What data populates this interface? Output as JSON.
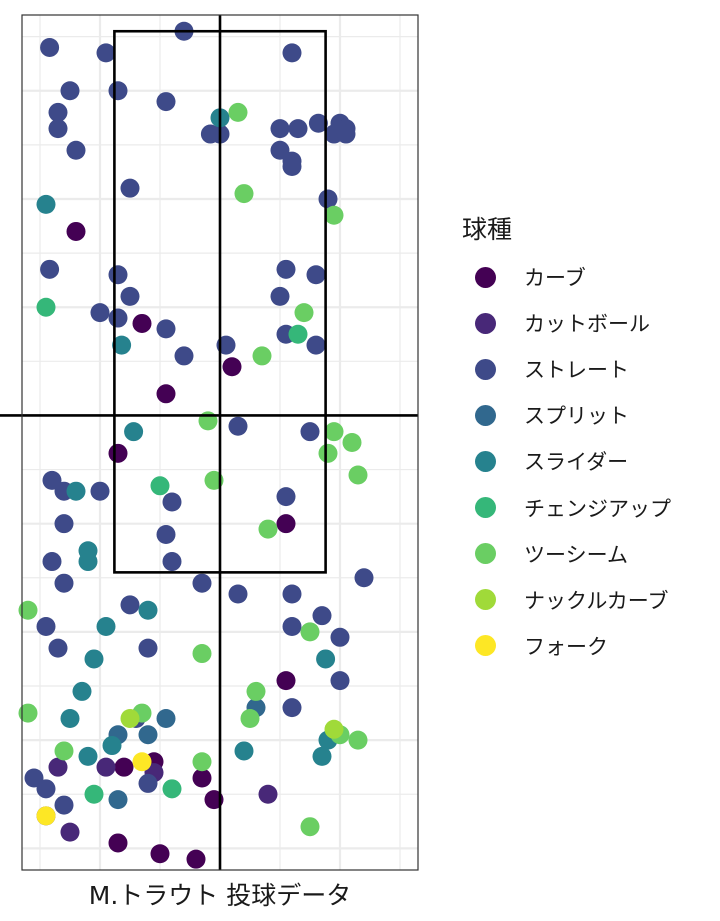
{
  "chart_data": {
    "type": "scatter",
    "title": "",
    "xlabel": "M.トラウト 投球データ",
    "ylabel": "",
    "xlim": [
      -1.65,
      1.65
    ],
    "ylim": [
      -1.2,
      6.7
    ],
    "grid": true,
    "legend_position": "right",
    "legend_title": "球種",
    "strike_zone": {
      "x": [
        -0.88,
        0.88
      ],
      "y": [
        1.55,
        6.55
      ]
    },
    "series": [
      {
        "name": "カーブ",
        "color": "#440154",
        "points": [
          [
            -1.2,
            4.7
          ],
          [
            -0.65,
            3.85
          ],
          [
            0.1,
            3.45
          ],
          [
            -0.45,
            3.2
          ],
          [
            -0.85,
            2.65
          ],
          [
            0.55,
            2.0
          ],
          [
            0.55,
            0.55
          ],
          [
            -0.8,
            -0.25
          ],
          [
            -0.55,
            -0.2
          ],
          [
            -0.15,
            -0.35
          ],
          [
            -0.05,
            -0.55
          ],
          [
            -0.5,
            -1.05
          ],
          [
            -0.2,
            -1.1
          ],
          [
            -0.85,
            -0.95
          ]
        ]
      },
      {
        "name": "カットボール",
        "color": "#482878",
        "points": [
          [
            -1.35,
            -0.25
          ],
          [
            -0.95,
            -0.25
          ],
          [
            -1.45,
            -0.7
          ],
          [
            -1.25,
            -0.85
          ],
          [
            0.4,
            -0.5
          ],
          [
            -0.55,
            -0.3
          ]
        ]
      },
      {
        "name": "ストレート",
        "color": "#3E4A89",
        "points": [
          [
            -1.42,
            6.4
          ],
          [
            -0.95,
            6.35
          ],
          [
            -0.3,
            6.55
          ],
          [
            0.6,
            6.35
          ],
          [
            -1.25,
            6.0
          ],
          [
            -0.85,
            6.0
          ],
          [
            -0.45,
            5.9
          ],
          [
            -1.35,
            5.8
          ],
          [
            -1.35,
            5.65
          ],
          [
            -1.2,
            5.45
          ],
          [
            -0.08,
            5.6
          ],
          [
            0.0,
            5.6
          ],
          [
            0.5,
            5.65
          ],
          [
            0.65,
            5.65
          ],
          [
            0.82,
            5.7
          ],
          [
            1.0,
            5.7
          ],
          [
            1.05,
            5.65
          ],
          [
            0.95,
            5.6
          ],
          [
            1.05,
            5.6
          ],
          [
            0.5,
            5.45
          ],
          [
            0.6,
            5.35
          ],
          [
            0.6,
            5.3
          ],
          [
            -0.75,
            5.1
          ],
          [
            0.9,
            5.0
          ],
          [
            -1.42,
            4.35
          ],
          [
            -0.85,
            4.3
          ],
          [
            0.55,
            4.35
          ],
          [
            0.8,
            4.3
          ],
          [
            -0.75,
            4.1
          ],
          [
            0.5,
            4.1
          ],
          [
            -1.0,
            3.95
          ],
          [
            -0.85,
            3.9
          ],
          [
            -0.45,
            3.8
          ],
          [
            0.55,
            3.75
          ],
          [
            0.05,
            3.65
          ],
          [
            0.8,
            3.65
          ],
          [
            -0.3,
            3.55
          ],
          [
            0.15,
            2.9
          ],
          [
            0.75,
            2.85
          ],
          [
            -1.4,
            2.4
          ],
          [
            -1.3,
            2.3
          ],
          [
            -1.0,
            2.3
          ],
          [
            0.55,
            2.25
          ],
          [
            -0.4,
            2.2
          ],
          [
            -1.3,
            2.0
          ],
          [
            -0.45,
            1.9
          ],
          [
            -1.4,
            1.65
          ],
          [
            -1.3,
            1.45
          ],
          [
            -0.4,
            1.65
          ],
          [
            -0.15,
            1.45
          ],
          [
            0.15,
            1.35
          ],
          [
            0.6,
            1.35
          ],
          [
            1.2,
            1.5
          ],
          [
            -0.75,
            1.25
          ],
          [
            0.85,
            1.15
          ],
          [
            -1.45,
            1.05
          ],
          [
            0.6,
            1.05
          ],
          [
            1.0,
            0.95
          ],
          [
            -1.35,
            0.85
          ],
          [
            -0.6,
            0.85
          ],
          [
            1.0,
            0.55
          ],
          [
            0.6,
            0.3
          ],
          [
            -0.7,
            0.2
          ],
          [
            -1.55,
            -0.35
          ],
          [
            -1.45,
            -0.45
          ],
          [
            -0.6,
            -0.4
          ],
          [
            -1.3,
            -0.6
          ]
        ]
      },
      {
        "name": "スプリット",
        "color": "#31688E",
        "points": [
          [
            -0.85,
            0.05
          ],
          [
            -0.6,
            0.05
          ],
          [
            -0.45,
            0.2
          ],
          [
            0.3,
            0.3
          ],
          [
            -0.85,
            -0.55
          ]
        ]
      },
      {
        "name": "スライダー",
        "color": "#26828E",
        "points": [
          [
            -1.45,
            4.95
          ],
          [
            -0.82,
            3.65
          ],
          [
            -0.72,
            2.85
          ],
          [
            -1.2,
            2.3
          ],
          [
            -1.1,
            1.75
          ],
          [
            -1.1,
            1.65
          ],
          [
            -0.95,
            1.05
          ],
          [
            0.0,
            5.75
          ],
          [
            -0.6,
            1.2
          ],
          [
            -1.05,
            0.75
          ],
          [
            0.88,
            0.75
          ],
          [
            -1.15,
            0.45
          ],
          [
            -1.25,
            0.2
          ],
          [
            0.9,
            0.0
          ],
          [
            -0.9,
            -0.05
          ],
          [
            0.2,
            -0.1
          ],
          [
            -1.1,
            -0.15
          ],
          [
            0.85,
            -0.15
          ]
        ]
      },
      {
        "name": "チェンジアップ",
        "color": "#35B779",
        "points": [
          [
            -1.45,
            4.0
          ],
          [
            0.65,
            3.75
          ],
          [
            -0.5,
            2.35
          ],
          [
            -1.05,
            -0.5
          ],
          [
            -0.4,
            -0.45
          ]
        ]
      },
      {
        "name": "ツーシーム",
        "color": "#6ACE63",
        "points": [
          [
            0.15,
            5.8
          ],
          [
            0.2,
            5.05
          ],
          [
            0.95,
            4.85
          ],
          [
            0.7,
            3.95
          ],
          [
            0.35,
            3.55
          ],
          [
            -0.1,
            2.95
          ],
          [
            0.95,
            2.85
          ],
          [
            1.1,
            2.75
          ],
          [
            0.9,
            2.65
          ],
          [
            1.15,
            2.45
          ],
          [
            -0.05,
            2.4
          ],
          [
            0.4,
            1.95
          ],
          [
            -1.6,
            1.2
          ],
          [
            0.75,
            1.0
          ],
          [
            -0.15,
            0.8
          ],
          [
            0.3,
            0.45
          ],
          [
            -0.65,
            0.25
          ],
          [
            -1.6,
            0.25
          ],
          [
            0.25,
            0.2
          ],
          [
            1.0,
            0.05
          ],
          [
            1.15,
            0.0
          ],
          [
            -1.3,
            -0.1
          ],
          [
            -0.15,
            -0.2
          ],
          [
            0.75,
            -0.8
          ]
        ]
      },
      {
        "name": "ナックルカーブ",
        "color": "#A0DA39",
        "points": [
          [
            -0.75,
            0.2
          ],
          [
            0.95,
            0.1
          ]
        ]
      },
      {
        "name": "フォーク",
        "color": "#FDE725",
        "points": [
          [
            -0.65,
            -0.2
          ],
          [
            -1.45,
            -0.7
          ]
        ]
      }
    ]
  }
}
